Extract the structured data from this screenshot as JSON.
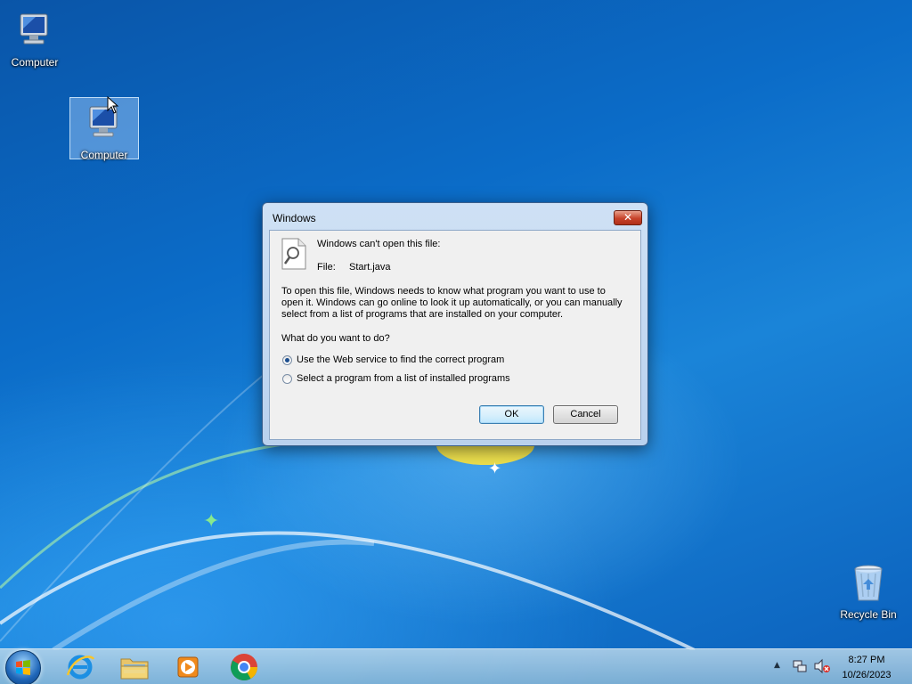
{
  "desktop": {
    "icons": [
      {
        "label": "Computer"
      },
      {
        "label": "Computer"
      },
      {
        "label": "Recycle Bin"
      }
    ]
  },
  "dialog": {
    "title": "Windows",
    "close_glyph": "✕",
    "heading": "Windows can't open this file:",
    "file_label": "File:",
    "file_name": "Start.java",
    "description": "To open this file, Windows needs to know what program you want to use to open it. Windows can go online to look it up automatically, or you can manually select from a list of programs that are installed on your computer.",
    "question": "What do you want to do?",
    "options": [
      {
        "label": "Use the Web service to find the correct program",
        "checked": true
      },
      {
        "label": "Select a program from a list of installed programs",
        "checked": false
      }
    ],
    "ok_label": "OK",
    "cancel_label": "Cancel"
  },
  "taskbar": {
    "apps": [
      "start-orb",
      "internet-explorer-icon",
      "file-explorer-icon",
      "media-player-icon",
      "chrome-icon"
    ],
    "tray": {
      "time": "8:27 PM",
      "date": "10/26/2023",
      "show_hidden_glyph": "▲"
    }
  },
  "colors": {
    "accent": "#1d4f8f",
    "close_button": "#c7432a"
  }
}
